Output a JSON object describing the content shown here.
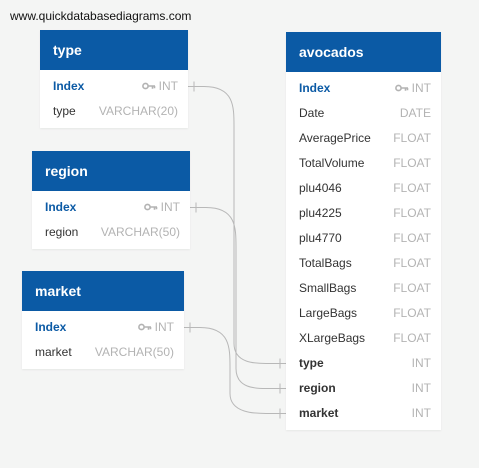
{
  "watermark": "www.quickdatabasediagrams.com",
  "tables": {
    "type": {
      "title": "type",
      "columns": [
        {
          "name": "Index",
          "type": "INT",
          "key": "pk"
        },
        {
          "name": "type",
          "type": "VARCHAR(20)",
          "key": ""
        }
      ]
    },
    "region": {
      "title": "region",
      "columns": [
        {
          "name": "Index",
          "type": "INT",
          "key": "pk"
        },
        {
          "name": "region",
          "type": "VARCHAR(50)",
          "key": ""
        }
      ]
    },
    "market": {
      "title": "market",
      "columns": [
        {
          "name": "Index",
          "type": "INT",
          "key": "pk"
        },
        {
          "name": "market",
          "type": "VARCHAR(50)",
          "key": ""
        }
      ]
    },
    "avocados": {
      "title": "avocados",
      "columns": [
        {
          "name": "Index",
          "type": "INT",
          "key": "pk"
        },
        {
          "name": "Date",
          "type": "DATE",
          "key": ""
        },
        {
          "name": "AveragePrice",
          "type": "FLOAT",
          "key": ""
        },
        {
          "name": "TotalVolume",
          "type": "FLOAT",
          "key": ""
        },
        {
          "name": "plu4046",
          "type": "FLOAT",
          "key": ""
        },
        {
          "name": "plu4225",
          "type": "FLOAT",
          "key": ""
        },
        {
          "name": "plu4770",
          "type": "FLOAT",
          "key": ""
        },
        {
          "name": "TotalBags",
          "type": "FLOAT",
          "key": ""
        },
        {
          "name": "SmallBags",
          "type": "FLOAT",
          "key": ""
        },
        {
          "name": "LargeBags",
          "type": "FLOAT",
          "key": ""
        },
        {
          "name": "XLargeBags",
          "type": "FLOAT",
          "key": ""
        },
        {
          "name": "type",
          "type": "INT",
          "key": "fk"
        },
        {
          "name": "region",
          "type": "INT",
          "key": "fk"
        },
        {
          "name": "market",
          "type": "INT",
          "key": "fk"
        }
      ]
    }
  },
  "relationships": [
    {
      "from_table": "type",
      "from_column": "Index",
      "to_table": "avocados",
      "to_column": "type"
    },
    {
      "from_table": "region",
      "from_column": "Index",
      "to_table": "avocados",
      "to_column": "region"
    },
    {
      "from_table": "market",
      "from_column": "Index",
      "to_table": "avocados",
      "to_column": "market"
    }
  ],
  "colors": {
    "header": "#0b5aa5",
    "link": "#b8b8b8",
    "type_text": "#b3b3b3"
  }
}
